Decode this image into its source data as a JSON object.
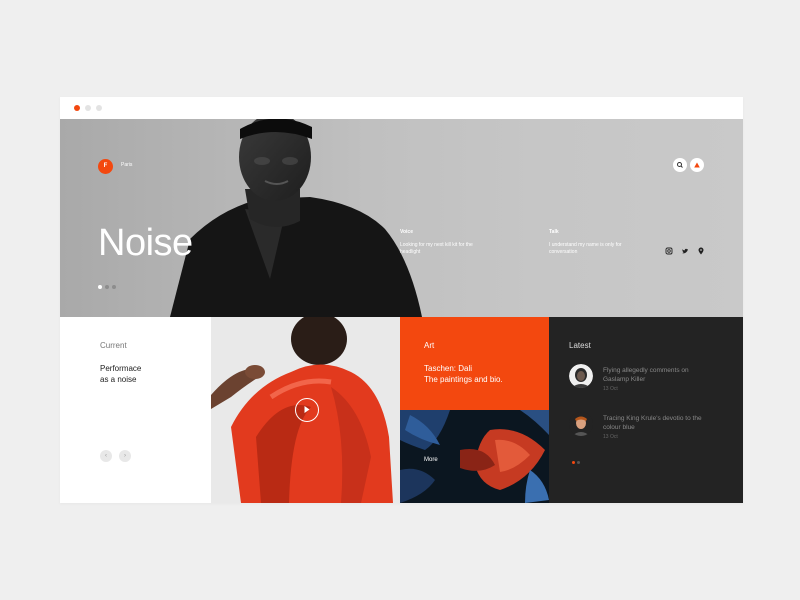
{
  "colors": {
    "accent": "#f3480f",
    "dark_panel": "#232323",
    "hero_gray": "#b6b6b6"
  },
  "window_controls": [
    "active",
    "inactive",
    "inactive"
  ],
  "hero": {
    "logo_letter": "F",
    "city": "Paris",
    "title": "Noise",
    "columns": [
      {
        "head": "Voice",
        "text": "Looking for my next kill kit for the headlight"
      },
      {
        "head": "Talk",
        "text": "I understand my name is only for conversation"
      }
    ],
    "action_icons": [
      "search-icon",
      "alert-icon"
    ],
    "social_icons": [
      "instagram-icon",
      "twitter-icon",
      "location-icon"
    ],
    "pager": {
      "count": 3,
      "active": 0
    }
  },
  "current": {
    "head": "Current",
    "title_line1": "Performace",
    "title_line2": "as a noise",
    "prev_icon": "chevron-left-icon",
    "next_icon": "chevron-right-icon"
  },
  "feature": {
    "play_icon": "play-icon"
  },
  "art": {
    "head": "Art",
    "text_line1": "Taschen: Dali",
    "text_line2": "The paintings and bio."
  },
  "more": {
    "label": "More"
  },
  "latest": {
    "head": "Latest",
    "items": [
      {
        "title": "Flying allegedly comments on Gaslamp Killer",
        "date": "13 Oct"
      },
      {
        "title": "Tracing King Krule's devotio to the colour blue",
        "date": "13 Oct"
      }
    ],
    "pager": {
      "count": 2,
      "active": 0
    }
  }
}
